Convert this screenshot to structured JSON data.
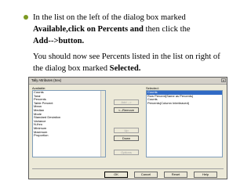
{
  "slide": {
    "bullet_line1_pre": "In the list on the left of the dialog box marked",
    "bullet_line2_bold": "Available,click on Percents and",
    "bullet_line2_rest": " then click the",
    "bullet_line3_bold": "Add-->button.",
    "para2_line1": "You should now see Percents listed in the list on right of",
    "para2_line2_pre": "the dialog box marked ",
    "para2_line2_bold": "Selected.",
    "bullet_color": "#7c9a22"
  },
  "dialog": {
    "title": "Tally Attributes (Sex)",
    "close_glyph": "x",
    "available_label": "Available:",
    "selected_label": "Selected:",
    "available_items": [
      "Counts",
      "Total",
      "Percents",
      "Table Percent",
      "Mean",
      "Median",
      "Mode",
      "Standard Deviation",
      "Variance",
      "N-thru",
      "Minimum",
      "Maximum",
      "Proportion"
    ],
    "selected_items": [
      "Counts",
      "Row Percent(Same as Percents)",
      "Counts",
      "Percents(Column Interleaved)"
    ],
    "selected_highlight_index": 0,
    "buttons": {
      "add": "Add -->",
      "remove": "<--Remove",
      "up": "Up",
      "down": "Down",
      "options": "Options",
      "ok": "OK",
      "cancel": "Cancel",
      "reset": "Reset",
      "help": "Help"
    }
  }
}
